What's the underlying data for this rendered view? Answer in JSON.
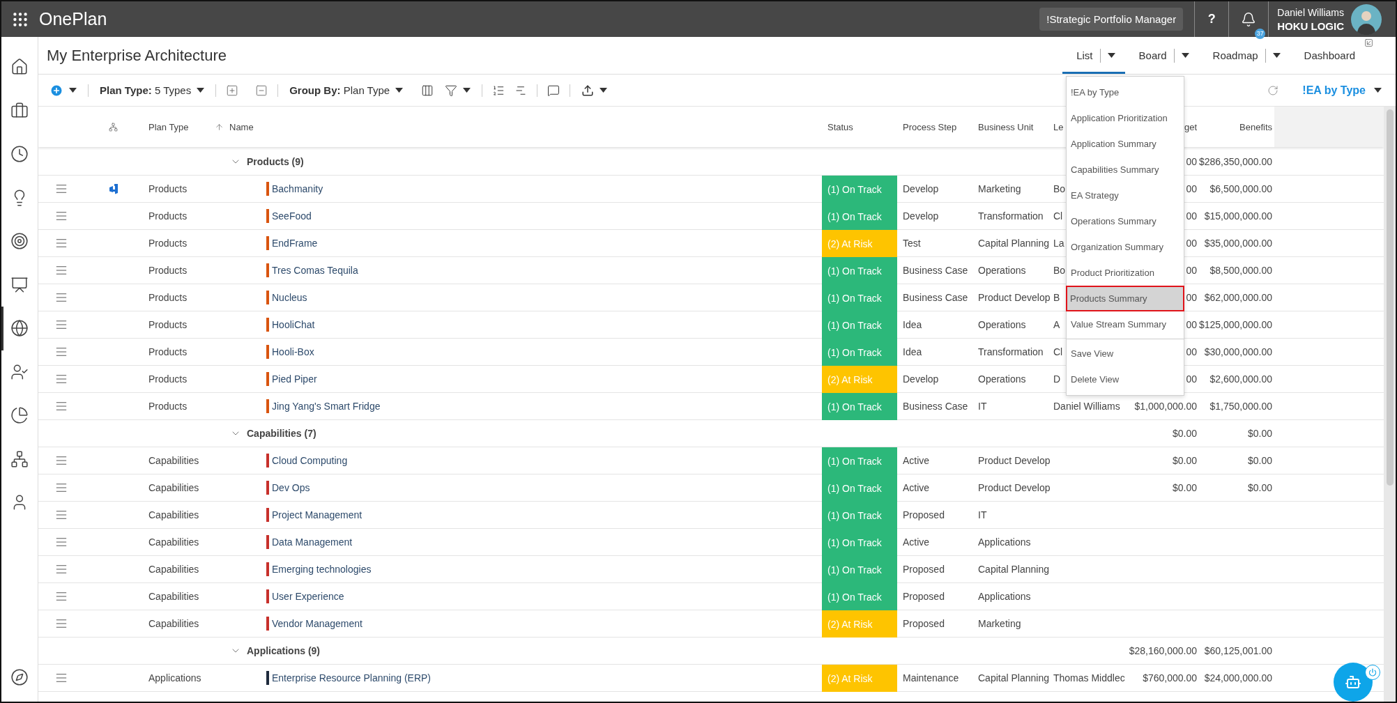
{
  "top_bar": {
    "app_title": "OnePlan",
    "workspace": "!Strategic Portfolio Manager",
    "help": "?",
    "notification_count": "37",
    "user_name": "Daniel Williams",
    "organization": "HOKU LOGIC"
  },
  "sidebar": {
    "items": [
      {
        "selected": false
      },
      {
        "selected": false
      },
      {
        "selected": false
      },
      {
        "selected": false
      },
      {
        "selected": false
      },
      {
        "selected": false
      },
      {
        "selected": true
      },
      {
        "selected": false
      },
      {
        "selected": false
      },
      {
        "selected": false
      },
      {
        "selected": false
      }
    ]
  },
  "page_title": "My Enterprise Architecture",
  "view_tabs": [
    {
      "label": "List",
      "selected": true,
      "dropdown": true
    },
    {
      "label": "Board",
      "selected": false,
      "dropdown": true
    },
    {
      "label": "Roadmap",
      "selected": false,
      "dropdown": true
    },
    {
      "label": "Dashboard",
      "selected": false,
      "dropdown": false
    }
  ],
  "toolbar": {
    "plan_type": "**Plan Type:** 5 Types",
    "group_by": "**Group By:** Plan Type",
    "current_view": "!EA by Type"
  },
  "view_menu": {
    "items": [
      {
        "label": "!EA by Type",
        "selected": false
      },
      {
        "label": "Application Prioritization",
        "selected": false
      },
      {
        "label": "Application Summary",
        "selected": false
      },
      {
        "label": "Capabilities Summary",
        "selected": false
      },
      {
        "label": "EA Strategy",
        "selected": false
      },
      {
        "label": "Operations Summary",
        "selected": false
      },
      {
        "label": "Organization Summary",
        "selected": false
      },
      {
        "label": "Product Prioritization",
        "selected": false
      },
      {
        "label": "Products Summary",
        "selected": true
      },
      {
        "label": "Value Stream Summary",
        "selected": false
      }
    ],
    "actions": [
      "Save View",
      "Delete View"
    ]
  },
  "table": {
    "columns": [
      {
        "label": "Plan Type",
        "sorted": false
      },
      {
        "label": "Name",
        "sorted": true
      },
      {
        "label": "Status",
        "sorted": false
      },
      {
        "label": "Process Step",
        "sorted": false
      },
      {
        "label": "Business Unit",
        "sorted": false
      },
      {
        "label": "Le",
        "sorted": false
      },
      {
        "label": "get",
        "sorted": false
      },
      {
        "label": "Benefits",
        "sorted": false
      }
    ],
    "groups": [
      {
        "label": "Products (9)",
        "color": "#d9540f",
        "budget": "00",
        "benefits": "$286,350,000.00",
        "rows": [
          {
            "plan_type": "Products",
            "name": "Bachmanity",
            "linked": true,
            "status": "(1) On Track",
            "color": "#2cb87a",
            "process_step": "Develop",
            "business_unit": "Marketing",
            "lead": "Bo",
            "budget": "00",
            "benefits": "$6,500,000.00"
          },
          {
            "plan_type": "Products",
            "name": "SeeFood",
            "linked": false,
            "status": "(1) On Track",
            "color": "#2cb87a",
            "process_step": "Develop",
            "business_unit": "Transformation",
            "lead": "Cl",
            "budget": "00",
            "benefits": "$15,000,000.00"
          },
          {
            "plan_type": "Products",
            "name": "EndFrame",
            "linked": false,
            "status": "(2) At Risk",
            "color": "#fec400",
            "process_step": "Test",
            "business_unit": "Capital Planning",
            "lead": "La",
            "budget": "00",
            "benefits": "$35,000,000.00"
          },
          {
            "plan_type": "Products",
            "name": "Tres Comas Tequila",
            "linked": false,
            "status": "(1) On Track",
            "color": "#2cb87a",
            "process_step": "Business Case",
            "business_unit": "Operations",
            "lead": "Bo",
            "budget": "00",
            "benefits": "$8,500,000.00"
          },
          {
            "plan_type": "Products",
            "name": "Nucleus",
            "linked": false,
            "status": "(1) On Track",
            "color": "#2cb87a",
            "process_step": "Business Case",
            "business_unit": "Product Develop",
            "lead": "B",
            "budget": "00",
            "benefits": "$62,000,000.00"
          },
          {
            "plan_type": "Products",
            "name": "HooliChat",
            "linked": false,
            "status": "(1) On Track",
            "color": "#2cb87a",
            "process_step": "Idea",
            "business_unit": "Operations",
            "lead": "A",
            "budget": "00",
            "benefits": "$125,000,000.00"
          },
          {
            "plan_type": "Products",
            "name": "Hooli-Box",
            "linked": false,
            "status": "(1) On Track",
            "color": "#2cb87a",
            "process_step": "Idea",
            "business_unit": "Transformation",
            "lead": "Cl",
            "budget": "00",
            "benefits": "$30,000,000.00"
          },
          {
            "plan_type": "Products",
            "name": "Pied Piper",
            "linked": false,
            "status": "(2) At Risk",
            "color": "#fec400",
            "process_step": "Develop",
            "business_unit": "Operations",
            "lead": "D",
            "budget": "00",
            "benefits": "$2,600,000.00"
          },
          {
            "plan_type": "Products",
            "name": "Jing Yang's Smart Fridge",
            "linked": false,
            "status": "(1) On Track",
            "color": "#2cb87a",
            "process_step": "Business Case",
            "business_unit": "IT",
            "lead": "Daniel Williams",
            "budget": "$1,000,000.00",
            "benefits": "$1,750,000.00"
          }
        ]
      },
      {
        "label": "Capabilities (7)",
        "color": "#c7302b",
        "budget": "$0.00",
        "benefits": "$0.00",
        "rows": [
          {
            "plan_type": "Capabilities",
            "name": "Cloud Computing",
            "linked": false,
            "status": "(1) On Track",
            "color": "#2cb87a",
            "process_step": "Active",
            "business_unit": "Product Develop",
            "budget": "$0.00",
            "benefits": "$0.00"
          },
          {
            "plan_type": "Capabilities",
            "name": "Dev Ops",
            "linked": false,
            "status": "(1) On Track",
            "color": "#2cb87a",
            "process_step": "Active",
            "business_unit": "Product Develop",
            "budget": "$0.00",
            "benefits": "$0.00"
          },
          {
            "plan_type": "Capabilities",
            "name": "Project Management",
            "linked": false,
            "status": "(1) On Track",
            "color": "#2cb87a",
            "process_step": "Proposed",
            "business_unit": "IT"
          },
          {
            "plan_type": "Capabilities",
            "name": "Data Management",
            "linked": false,
            "status": "(1) On Track",
            "color": "#2cb87a",
            "process_step": "Active",
            "business_unit": "Applications"
          },
          {
            "plan_type": "Capabilities",
            "name": "Emerging technologies",
            "linked": false,
            "status": "(1) On Track",
            "color": "#2cb87a",
            "process_step": "Proposed",
            "business_unit": "Capital Planning"
          },
          {
            "plan_type": "Capabilities",
            "name": "User Experience",
            "linked": false,
            "status": "(1) On Track",
            "color": "#2cb87a",
            "process_step": "Proposed",
            "business_unit": "Applications"
          },
          {
            "plan_type": "Capabilities",
            "name": "Vendor Management",
            "linked": false,
            "status": "(2) At Risk",
            "color": "#fec400",
            "process_step": "Proposed",
            "business_unit": "Marketing"
          }
        ]
      },
      {
        "label": "Applications (9)",
        "color": "#1f2b3d",
        "budget": "$28,160,000.00",
        "benefits": "$60,125,001.00",
        "rows": [
          {
            "plan_type": "Applications",
            "name": "Enterprise Resource Planning (ERP)",
            "linked": false,
            "status": "(2) At Risk",
            "color": "#fec400",
            "process_step": "Maintenance",
            "business_unit": "Capital Planning",
            "lead": "Thomas Middlec",
            "budget": "$760,000.00",
            "benefits": "$24,000,000.00"
          }
        ]
      }
    ]
  }
}
